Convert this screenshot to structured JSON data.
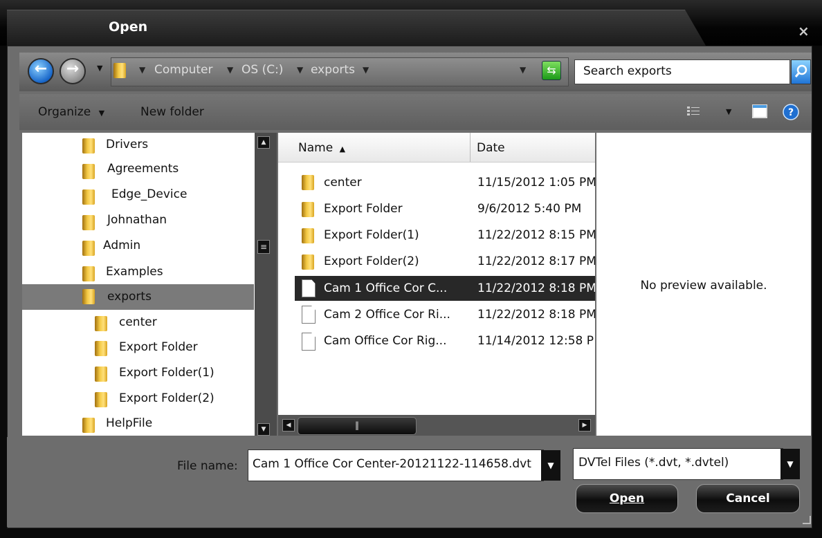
{
  "window": {
    "title": "Open",
    "close_glyph": "×"
  },
  "address_bar": {
    "back_icon": "back-arrow-icon",
    "forward_icon": "forward-arrow-icon",
    "breadcrumb": [
      "Computer",
      "OS (C:)",
      "exports"
    ],
    "search_placeholder": "Search exports",
    "accent": "#1f74d6"
  },
  "toolbar": {
    "organize_label": "Organize",
    "new_folder_label": "New folder"
  },
  "nav_tree": {
    "items": [
      {
        "label": "Drivers"
      },
      {
        "label": "Agreements"
      },
      {
        "label": "Edge_Device"
      },
      {
        "label": "Johnathan"
      },
      {
        "label": "Admin"
      },
      {
        "label": "Examples"
      },
      {
        "label": "exports",
        "selected": true
      },
      {
        "label": "center"
      },
      {
        "label": "Export Folder"
      },
      {
        "label": "Export Folder(1)"
      },
      {
        "label": "Export Folder(2)"
      },
      {
        "label": "HelpFile"
      }
    ]
  },
  "file_list": {
    "columns": {
      "name": "Name",
      "sort_glyph": "▲",
      "date": "Date"
    },
    "rows": [
      {
        "name": "center",
        "date": "11/15/2012 1:05 PM",
        "type": "folder"
      },
      {
        "name": "Export Folder",
        "date": "9/6/2012 5:40 PM",
        "type": "folder"
      },
      {
        "name": "Export Folder(1)",
        "date": "11/22/2012 8:15 PM",
        "type": "folder"
      },
      {
        "name": "Export Folder(2)",
        "date": "11/22/2012 8:17 PM",
        "type": "folder"
      },
      {
        "name": "Cam 1 Office Cor C...",
        "date": "11/22/2012 8:18 PM",
        "type": "file",
        "selected": true
      },
      {
        "name": "Cam 2 Office Cor Ri...",
        "date": "11/22/2012 8:18 PM",
        "type": "file"
      },
      {
        "name": "Cam Office Cor Rig...",
        "date": "11/14/2012 12:58 P",
        "type": "file"
      }
    ]
  },
  "preview": {
    "text": "No preview available."
  },
  "footer": {
    "file_name_label": "File name:",
    "file_name_value": "Cam 1 Office Cor Center-20121122-114658.dvt",
    "file_type_value": "DVTel Files (*.dvt, *.dvtel)",
    "open_label": "Open",
    "cancel_label": "Cancel"
  }
}
